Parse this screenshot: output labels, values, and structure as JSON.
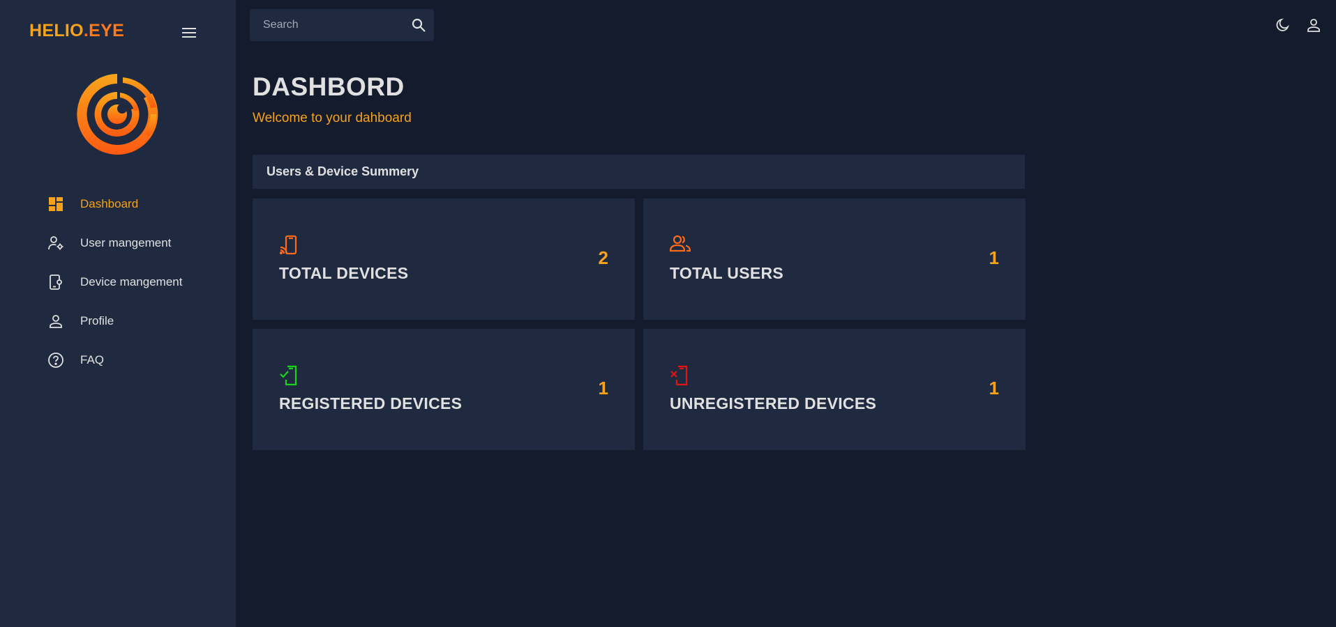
{
  "sidebar": {
    "brand": {
      "part1": "HELIO",
      "dot": ".",
      "part2": "EYE"
    },
    "menu_icon": "hamburger-menu-icon",
    "items": [
      {
        "label": "Dashboard",
        "icon": "dashboard-icon",
        "active": true
      },
      {
        "label": "User mangement",
        "icon": "user-settings-icon",
        "active": false
      },
      {
        "label": "Device mangement",
        "icon": "device-settings-icon",
        "active": false
      },
      {
        "label": "Profile",
        "icon": "person-icon",
        "active": false
      },
      {
        "label": "FAQ",
        "icon": "help-circle-icon",
        "active": false
      }
    ]
  },
  "topbar": {
    "search": {
      "placeholder": "Search",
      "icon": "search-icon"
    },
    "icons": [
      "moon-icon",
      "person-icon"
    ]
  },
  "header": {
    "title": "DASHBORD",
    "subtitle": "Welcome to your dahboard"
  },
  "summary": {
    "title": "Users & Device Summery",
    "cards": [
      {
        "label": "TOTAL DEVICES",
        "value": "2",
        "icon": "phone-cast-icon",
        "icon_color": "#ff6a1a"
      },
      {
        "label": "TOTAL USERS",
        "value": "1",
        "icon": "people-icon",
        "icon_color": "#ff6a1a"
      },
      {
        "label": "REGISTERED DEVICES",
        "value": "1",
        "icon": "phone-check-icon",
        "icon_color": "#1bd11b"
      },
      {
        "label": "UNREGISTERED DEVICES",
        "value": "1",
        "icon": "phone-x-icon",
        "icon_color": "#e01414"
      }
    ]
  },
  "colors": {
    "accent": "#f6a21a",
    "background": "#141b2d",
    "panel": "#1f2a40",
    "text": "#e0e0e0"
  }
}
